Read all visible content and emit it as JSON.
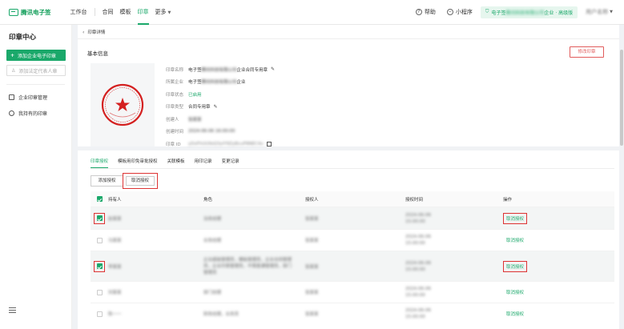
{
  "topbar": {
    "logo": "腾讯电子签",
    "nav_main": "工作台",
    "nav": [
      {
        "label": "合同",
        "active": false
      },
      {
        "label": "模板",
        "active": false
      },
      {
        "label": "印章",
        "active": true
      },
      {
        "label": "更多",
        "active": false
      }
    ],
    "help": "帮助",
    "mini_program": "小程序",
    "org_prefix": "电子签",
    "org_blur": "腾讯科技有限公司",
    "org_suffix": "企业 · 高级版",
    "user": "用户名称"
  },
  "sidebar": {
    "title": "印章中心",
    "add_org_seal": "添加企业电子印章",
    "add_personal_seal": "添加法定代表人章",
    "items": [
      {
        "label": "企业印章管理",
        "icon": "stamp-icon"
      },
      {
        "label": "我持有的印章",
        "icon": "user-circle-icon"
      }
    ]
  },
  "detail": {
    "breadcrumb": "印章详情",
    "section_title": "基本信息",
    "edit_button": "修改印章",
    "fields": [
      {
        "label": "印章名称",
        "value_pre": "电子签",
        "value_blur": "腾讯科技有限公司",
        "value_post": "企业合同专用章",
        "editable": true
      },
      {
        "label": "所属企业",
        "value_pre": "电子签",
        "value_blur": "腾讯科技有限公司",
        "value_post": "企业",
        "editable": false
      },
      {
        "label": "印章状态",
        "value_pre": "已启用",
        "value_blur": "",
        "value_post": "",
        "editable": false
      },
      {
        "label": "印章类型",
        "value_pre": "合同专用章",
        "value_blur": "",
        "value_post": "",
        "editable": true
      },
      {
        "label": "创建人",
        "value_pre": "",
        "value_blur": "张某某",
        "value_post": "",
        "editable": false
      },
      {
        "label": "创建时间",
        "value_pre": "",
        "value_blur": "2024-06-06 16:00:00",
        "value_post": "",
        "editable": false
      },
      {
        "label": "印章 ID",
        "value_pre": "",
        "value_blur": "yDxFhUU9sQ3ylY9ZyBcuP9NEC4x",
        "value_post": "",
        "copy": true
      }
    ],
    "status_color": "#1aa86a"
  },
  "auth": {
    "tabs": [
      {
        "label": "印章授权",
        "active": true
      },
      {
        "label": "模板用印免审批授权",
        "active": false
      },
      {
        "label": "关联模板",
        "active": false
      },
      {
        "label": "用印记录",
        "active": false
      },
      {
        "label": "变更记录",
        "active": false
      }
    ],
    "add_button": "添加授权",
    "cancel_button": "取消授权",
    "columns": [
      "持有人",
      "角色",
      "授权人",
      "授权时间",
      "操作"
    ],
    "rows": [
      {
        "checked": true,
        "holder": "赵某某",
        "role": "法务经理",
        "grantor": "张某某",
        "date": "2024-06-06",
        "time": "15:00:00",
        "action": "取消授权",
        "highlight": true
      },
      {
        "checked": false,
        "holder": "马某某",
        "role": "业务经理",
        "grantor": "张某某",
        "date": "2024-06-06",
        "time": "15:00:00",
        "action": "取消授权",
        "highlight": false
      },
      {
        "checked": true,
        "holder": "李某某",
        "role": "企业超级管理员，模板管理员，企业合同管理员，企业印章管理员，不限普通管理员，部门管理员",
        "grantor": "张某某",
        "date": "2024-06-06",
        "time": "15:00:00",
        "action": "取消授权",
        "highlight": true
      },
      {
        "checked": false,
        "holder": "刘某某",
        "role": "部门经理",
        "grantor": "张某某",
        "date": "2024-06-06",
        "time": "15:00:00",
        "action": "取消授权",
        "highlight": false
      },
      {
        "checked": false,
        "holder": "陈一一",
        "role": "财务经理，业务员",
        "grantor": "张某某",
        "date": "2024-06-06",
        "time": "15:00:00",
        "action": "取消授权",
        "highlight": false
      }
    ]
  },
  "colors": {
    "accent": "#1aa86a",
    "danger": "#d33333",
    "seal": "#d42020"
  }
}
